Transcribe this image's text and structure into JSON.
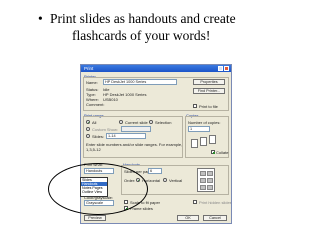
{
  "bullet": {
    "marker": "•",
    "line1": "Print slides as handouts and create",
    "line2": "flashcards of your words!"
  },
  "dialog": {
    "title": "Print",
    "printer_section": "Printer",
    "name_label": "Name:",
    "name_value": "HP DeskJet 1000 Series",
    "status_label": "Status:",
    "status_value": "Idle",
    "type_label": "Type:",
    "type_value": "HP DeskJet 1000 Series",
    "where_label": "Where:",
    "where_value": "USB010",
    "comment_label": "Comment:",
    "properties_button": "Properties",
    "find_printer_button": "Find Printer...",
    "print_to_file_label": "Print to file",
    "print_range_section": "Print range",
    "all_label": "All",
    "current_slide_label": "Current slide",
    "selection_label": "Selection",
    "custom_show_label": "Custom Show:",
    "slides_label": "Slides:",
    "slides_value": "1-14",
    "range_hint_line1": "Enter slide numbers and/or slide ranges. For example,",
    "range_hint_line2": "1,3,5-12",
    "copies_section": "Copies",
    "number_of_copies_label": "Number of copies:",
    "copies_value": "1",
    "collate_label": "Collate",
    "print_what_label": "Print what:",
    "print_what_value": "Handouts",
    "handouts_section": "Handouts",
    "slides_per_page_label": "Slides per page:",
    "slides_per_page_value": "6",
    "order_label": "Order:",
    "horizontal_label": "Horizontal",
    "vertical_label": "Vertical",
    "color_label": "Color/grayscale:",
    "color_value": "Grayscale",
    "scale_to_fit_label": "Scale to fit paper",
    "frame_slides_label": "Frame slides",
    "print_hidden_label": "Print hidden slides",
    "preview_button": "Preview",
    "ok_button": "OK",
    "cancel_button": "Cancel"
  },
  "print_what_options": [
    "Slides",
    "Handouts",
    "Notes Pages",
    "Outline View"
  ],
  "selected_option": "Handouts"
}
